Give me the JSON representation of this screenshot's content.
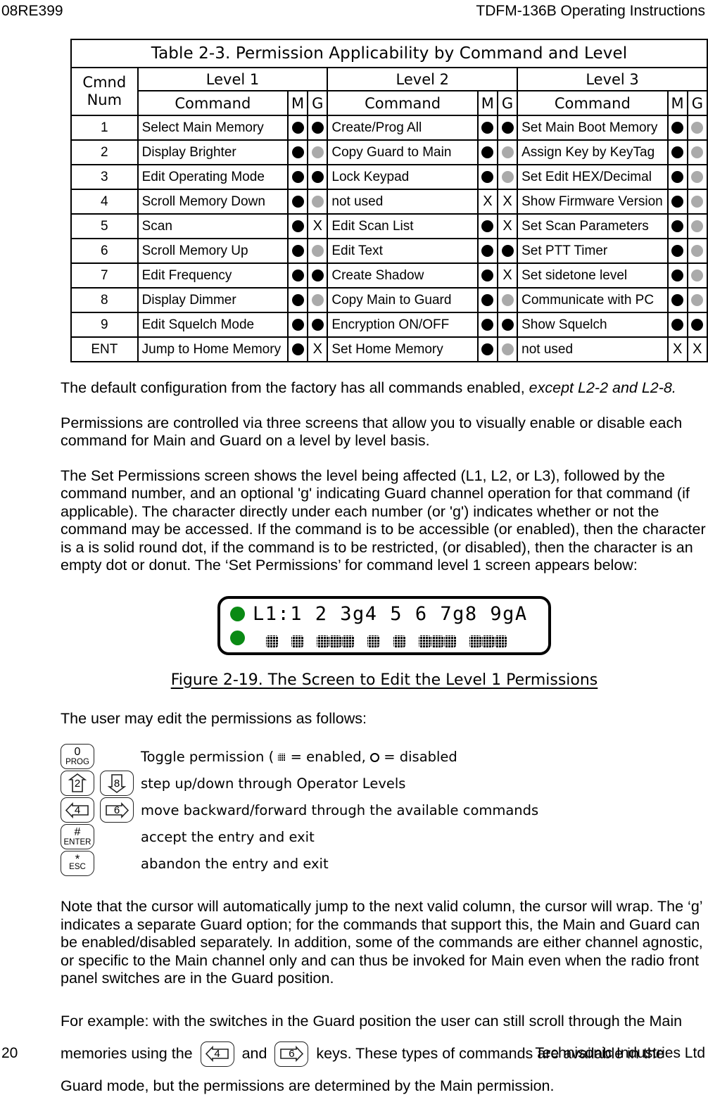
{
  "header": {
    "left": "08RE399",
    "right": "TDFM-136B Operating Instructions"
  },
  "footer": {
    "page_number": "20",
    "company": "Technisonic Industries Ltd"
  },
  "table": {
    "title": "Table 2-3. Permission Applicability by Command and Level",
    "cmnd_num_label_line1": "Cmnd",
    "cmnd_num_label_line2": "Num",
    "level_headers": [
      "Level 1",
      "Level 2",
      "Level 3"
    ],
    "sub_headers": {
      "command": "Command",
      "m": "M",
      "g": "G"
    },
    "rows": [
      {
        "num": "1",
        "l1": {
          "command": "Select Main Memory",
          "m": "on",
          "g": "on"
        },
        "l2": {
          "command": "Create/Prog All",
          "m": "on",
          "g": "on"
        },
        "l3": {
          "command": "Set Main Boot Memory",
          "m": "on",
          "g": "off"
        }
      },
      {
        "num": "2",
        "l1": {
          "command": "Display Brighter",
          "m": "on",
          "g": "off"
        },
        "l2": {
          "command": "Copy Guard to Main",
          "m": "on",
          "g": "off"
        },
        "l3": {
          "command": "Assign Key by KeyTag",
          "m": "on",
          "g": "off"
        }
      },
      {
        "num": "3",
        "l1": {
          "command": "Edit Operating Mode",
          "m": "on",
          "g": "on"
        },
        "l2": {
          "command": "Lock Keypad",
          "m": "on",
          "g": "off"
        },
        "l3": {
          "command": "Set Edit HEX/Decimal",
          "m": "on",
          "g": "off"
        }
      },
      {
        "num": "4",
        "l1": {
          "command": "Scroll Memory Down",
          "m": "on",
          "g": "off"
        },
        "l2": {
          "command": "not used",
          "m": "X",
          "g": "X"
        },
        "l3": {
          "command": "Show Firmware Version",
          "m": "on",
          "g": "off"
        }
      },
      {
        "num": "5",
        "l1": {
          "command": "Scan",
          "m": "on",
          "g": "X"
        },
        "l2": {
          "command": "Edit Scan List",
          "m": "on",
          "g": "X"
        },
        "l3": {
          "command": "Set Scan Parameters",
          "m": "on",
          "g": "off"
        }
      },
      {
        "num": "6",
        "l1": {
          "command": "Scroll Memory Up",
          "m": "on",
          "g": "off"
        },
        "l2": {
          "command": "Edit Text",
          "m": "on",
          "g": "on"
        },
        "l3": {
          "command": "Set PTT Timer",
          "m": "on",
          "g": "off"
        }
      },
      {
        "num": "7",
        "l1": {
          "command": "Edit Frequency",
          "m": "on",
          "g": "on"
        },
        "l2": {
          "command": "Create Shadow",
          "m": "on",
          "g": "X"
        },
        "l3": {
          "command": "Set sidetone level",
          "m": "on",
          "g": "off"
        }
      },
      {
        "num": "8",
        "l1": {
          "command": "Display Dimmer",
          "m": "on",
          "g": "off"
        },
        "l2": {
          "command": "Copy Main to Guard",
          "m": "on",
          "g": "off"
        },
        "l3": {
          "command": "Communicate with PC",
          "m": "on",
          "g": "off"
        }
      },
      {
        "num": "9",
        "l1": {
          "command": "Edit Squelch Mode",
          "m": "on",
          "g": "on"
        },
        "l2": {
          "command": "Encryption ON/OFF",
          "m": "on",
          "g": "on"
        },
        "l3": {
          "command": "Show Squelch",
          "m": "on",
          "g": "on"
        }
      },
      {
        "num": "ENT",
        "l1": {
          "command": "Jump to Home Memory",
          "m": "on",
          "g": "X"
        },
        "l2": {
          "command": "Set Home Memory",
          "m": "on",
          "g": "off"
        },
        "l3": {
          "command": "not used",
          "m": "X",
          "g": "X"
        }
      }
    ]
  },
  "paragraphs": {
    "default_config_plain": "The default configuration from the factory has all commands enabled, ",
    "default_config_italic": "except L2-2 and L2-8.",
    "permissions_controlled": "Permissions are controlled via three screens that allow you to visually enable or disable each command for Main and Guard on a level by level basis.",
    "set_permissions": "The Set Permissions screen shows the level being affected (L1, L2, or L3), followed by the command number, and an optional 'g' indicating Guard channel operation for that command (if applicable). The character directly under each number (or 'g') indicates whether or not the command may be accessed. If the command is to be accessible (or enabled), then the character is a is solid round dot, if the command is to be restricted, (or disabled), then the character is an empty dot or donut. The ‘Set Permissions’ for command level 1 screen appears below:",
    "user_may_edit": "The user may edit the permissions as follows:",
    "note_cursor": "Note that the cursor will automatically jump to the next valid column, the cursor will wrap. The ‘g’ indicates a separate Guard option; for the commands that support this, the Main and Guard can be enabled/disabled separately. In addition, some of the commands are either channel agnostic, or specific to the Main channel only and can thus be invoked for Main even when the radio front panel switches are in the Guard position.",
    "example_part1": "For example: with the switches in the Guard position the user can still scroll through the Main memories using the ",
    "example_part2": " and ",
    "example_part3": " keys.  These types of commands are available in the Guard mode, but the permissions are determined by the Main permission."
  },
  "lcd": {
    "line1": "L1:1 2 3g4 5 6 7g8 9gA",
    "led_color": "#0a8a14",
    "marker_slots": [
      "",
      "b",
      "",
      "b",
      "",
      "b",
      "b",
      "b",
      "",
      "b",
      "",
      "b",
      "",
      "b",
      "b",
      "b",
      "",
      "b",
      "b",
      "b"
    ]
  },
  "figure": {
    "caption": "Figure 2-19. The Screen to Edit the Level 1 Permissions"
  },
  "keys": [
    {
      "caps": [
        {
          "style": "plain",
          "main": "0",
          "sub": "PROG"
        }
      ],
      "description_pre": "Toggle permission ( ",
      "description_mid": " = enabled, ",
      "description_post": " = disabled",
      "has_symbols": true
    },
    {
      "caps": [
        {
          "style": "arrow-up",
          "main": "2",
          "sub": ""
        },
        {
          "style": "arrow-down",
          "main": "8",
          "sub": ""
        }
      ],
      "description": "step up/down through Operator Levels"
    },
    {
      "caps": [
        {
          "style": "arrow-left",
          "main": "4",
          "sub": ""
        },
        {
          "style": "arrow-right",
          "main": "6",
          "sub": ""
        }
      ],
      "description": "move backward/forward through the available commands"
    },
    {
      "caps": [
        {
          "style": "plain",
          "main": "#",
          "sub": "ENTER"
        }
      ],
      "description": "accept the entry and exit"
    },
    {
      "caps": [
        {
          "style": "plain",
          "main": "*",
          "sub": "ESC"
        }
      ],
      "description": "abandon the entry and exit"
    }
  ],
  "inline_keys": {
    "left": "4",
    "right": "6"
  }
}
